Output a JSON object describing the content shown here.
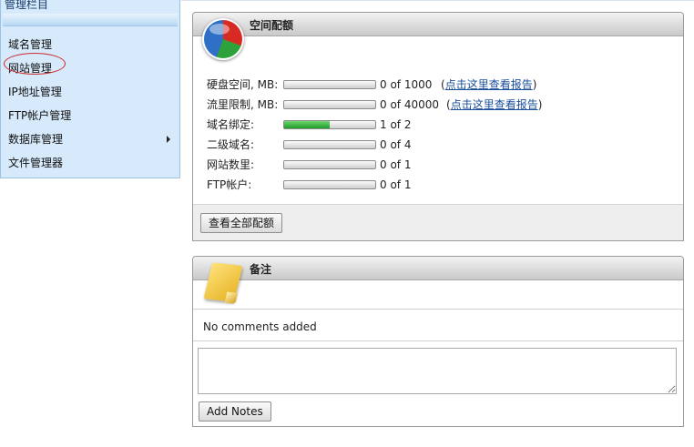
{
  "sidebar": {
    "title": "管理栏目",
    "items": [
      {
        "label": "域名管理"
      },
      {
        "label": "网站管理"
      },
      {
        "label": "IP地址管理"
      },
      {
        "label": "FTP帐户管理"
      },
      {
        "label": "数据库管理"
      },
      {
        "label": "文件管理器"
      }
    ]
  },
  "quota": {
    "title": "空间配额",
    "rows": [
      {
        "label": "硬盘空间, MB:",
        "usage": 0,
        "value": "0 of 1000",
        "link": "点击这里查看报告"
      },
      {
        "label": "流里限制, MB:",
        "usage": 0,
        "value": "0 of 40000",
        "link": "点击这里查看报告"
      },
      {
        "label": "域名绑定:",
        "usage": 0.5,
        "value": "1 of 2"
      },
      {
        "label": "二级域名:",
        "usage": 0,
        "value": "0 of 4"
      },
      {
        "label": "网站数里:",
        "usage": 0,
        "value": "0 of 1"
      },
      {
        "label": "FTP帐户:",
        "usage": 0,
        "value": "0 of 1"
      }
    ],
    "view_all_button": "查看全部配额"
  },
  "notes": {
    "title": "备注",
    "empty_text": "No comments added",
    "add_button": "Add Notes",
    "textarea_value": ""
  }
}
